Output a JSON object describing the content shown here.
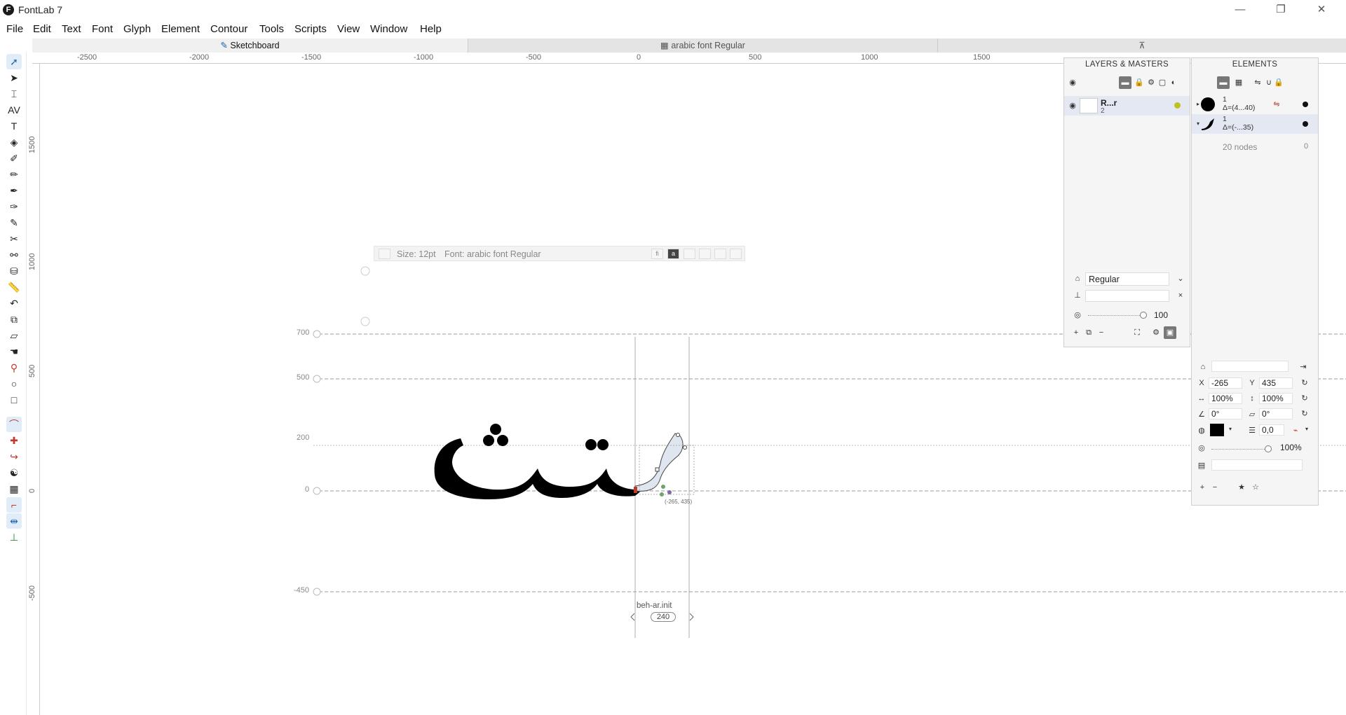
{
  "app": {
    "title": "FontLab 7"
  },
  "menu": [
    "File",
    "Edit",
    "Text",
    "Font",
    "Glyph",
    "Element",
    "Contour",
    "Tools",
    "Scripts",
    "View",
    "Window",
    "Help"
  ],
  "tabs": {
    "sketchboard": "Sketchboard",
    "font": "arabic font Regular"
  },
  "ruler": {
    "horizontal": [
      "-2500",
      "-2000",
      "-1500",
      "-1000",
      "-500",
      "0",
      "500",
      "1000",
      "1500"
    ],
    "vertical": [
      "1500",
      "1000",
      "500",
      "0",
      "-500"
    ]
  },
  "metrics": {
    "ascender": "700",
    "xheight": "500",
    "caps": "200",
    "baseline": "0",
    "descender": "-450"
  },
  "preview": {
    "size": "Size: 12pt",
    "font": "Font: arabic font Regular"
  },
  "glyph": {
    "name": "beh-ar.init",
    "width": "240",
    "selection_coords": "(-265, 435)"
  },
  "layers_panel": {
    "title": "LAYERS & MASTERS",
    "layer": {
      "name": "R...r",
      "sub": "2"
    },
    "master_name": "Regular",
    "opacity": "100"
  },
  "elements_panel": {
    "title": "ELEMENTS",
    "elements": [
      {
        "line1": "1",
        "line2": "Δ=(4...40)"
      },
      {
        "line1": "1",
        "line2": "Δ=(-...35)"
      }
    ],
    "nodes": "20 nodes",
    "nodes_count": "0",
    "x": "-265",
    "y": "435",
    "scale_x": "100%",
    "scale_y": "100%",
    "rotation": "0°",
    "slant": "0°",
    "stroke": "0,0",
    "opacity": "100%",
    "x_label": "X",
    "y_label": "Y"
  },
  "colors": {
    "fill": "#000000",
    "layer_dot": "#bcc21e",
    "accent": "#2066b0"
  }
}
